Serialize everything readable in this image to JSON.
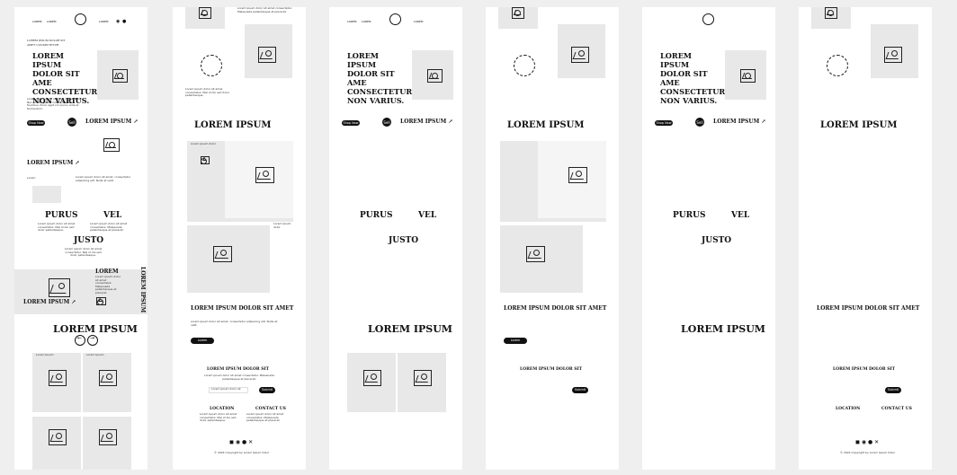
{
  "brand": {
    "small_text": "LOREM IPSUM"
  },
  "nav": {
    "left": "LOREM",
    "mid": "LOREM",
    "right": "LOREM"
  },
  "hero": {
    "overline": "LOREM IPSUM DOLOR SIT AMET CONSECTETUR",
    "title": "LOREM IPSUM DOLOR SIT AME CONSECTETUR. NON VARIUS.",
    "title_alt": "LOREM IPSUM DOLOR SIT AME CONSECTETUR. NON VARIUS.",
    "body": "Lorem ipsum dolor sit amet consectetur. Nec amet egestas mattis id tortor faucibus. Nunc eget orci purus ante at fermentum.",
    "btn": "Shop Now",
    "circle_btn": "Sell",
    "cta": "LOREM IPSUM ↗"
  },
  "section": {
    "heading": "LOREM IPSUM",
    "heading2": "LOREM IPSUM DOLOR SIT AMET",
    "heading3": "LOREM IPSUM DOLOR SIT",
    "words": [
      "PURUS",
      "VEL",
      "JUSTO"
    ],
    "lorem_small": "LOREM IPSUM ↗",
    "lorem": "LOREM",
    "lorem_vertical": "LOREM IPSUM"
  },
  "grid": {
    "label": "Lorem Ipsum",
    "label2": "Lorem ipsum dolor",
    "label3": "Lorem",
    "label4": "Lorem"
  },
  "newsletter": {
    "placeholder": "Lorem ipsum dolor sit",
    "btn": "Submit"
  },
  "contact": {
    "left": "LOCATION",
    "right": "CONTACT US"
  },
  "footer": {
    "copyright": "© 2024 Copyright by Lorem Ipsum Dolor"
  },
  "copy": {
    "p": "Lorem ipsum dolor sit amet consectetur. Malesuada pellentesque et placerat.",
    "p2": "Lorem ipsum dolor sit amet consectetur. Nisl id dui sed dolor pellentesque.",
    "p3": "Lorem ipsum dolor sit amet, consectetur adipiscing elit. Nulla at velit."
  },
  "colors": {
    "accent": "#111111",
    "panel": "#e8e8e8",
    "page": "#efefef"
  }
}
